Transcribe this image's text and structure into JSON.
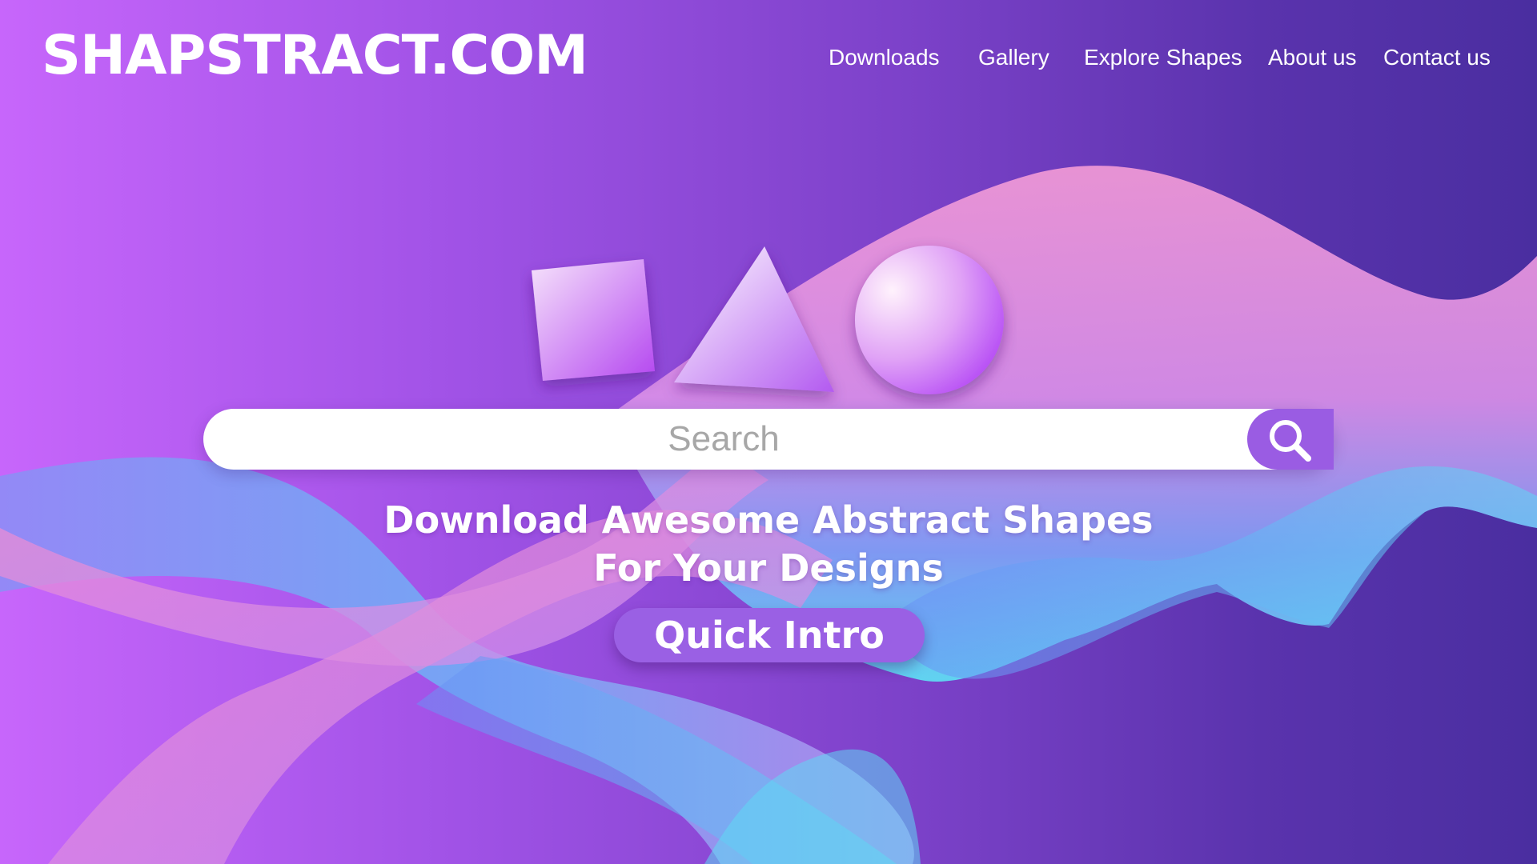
{
  "site": {
    "logo": "SHAPSTRACT.COM"
  },
  "nav": {
    "items": [
      {
        "label": "Downloads"
      },
      {
        "label": "Gallery"
      },
      {
        "label": "Explore Shapes"
      },
      {
        "label": "About us"
      },
      {
        "label": "Contact us"
      }
    ]
  },
  "hero": {
    "shapes": [
      "square-icon",
      "triangle-icon",
      "circle-icon"
    ],
    "search": {
      "placeholder": "Search",
      "icon": "search-icon"
    },
    "headline_line1": "Download Awesome Abstract Shapes",
    "headline_line2": "For Your Designs",
    "cta_label": "Quick Intro"
  },
  "colors": {
    "bg_start": "#c766fb",
    "bg_end": "#4a2ea0",
    "accent": "#9a5ce3",
    "wave_pink": "#f39ad2",
    "wave_blue": "#6a9af5",
    "wave_cyan": "#5ee0f4"
  }
}
